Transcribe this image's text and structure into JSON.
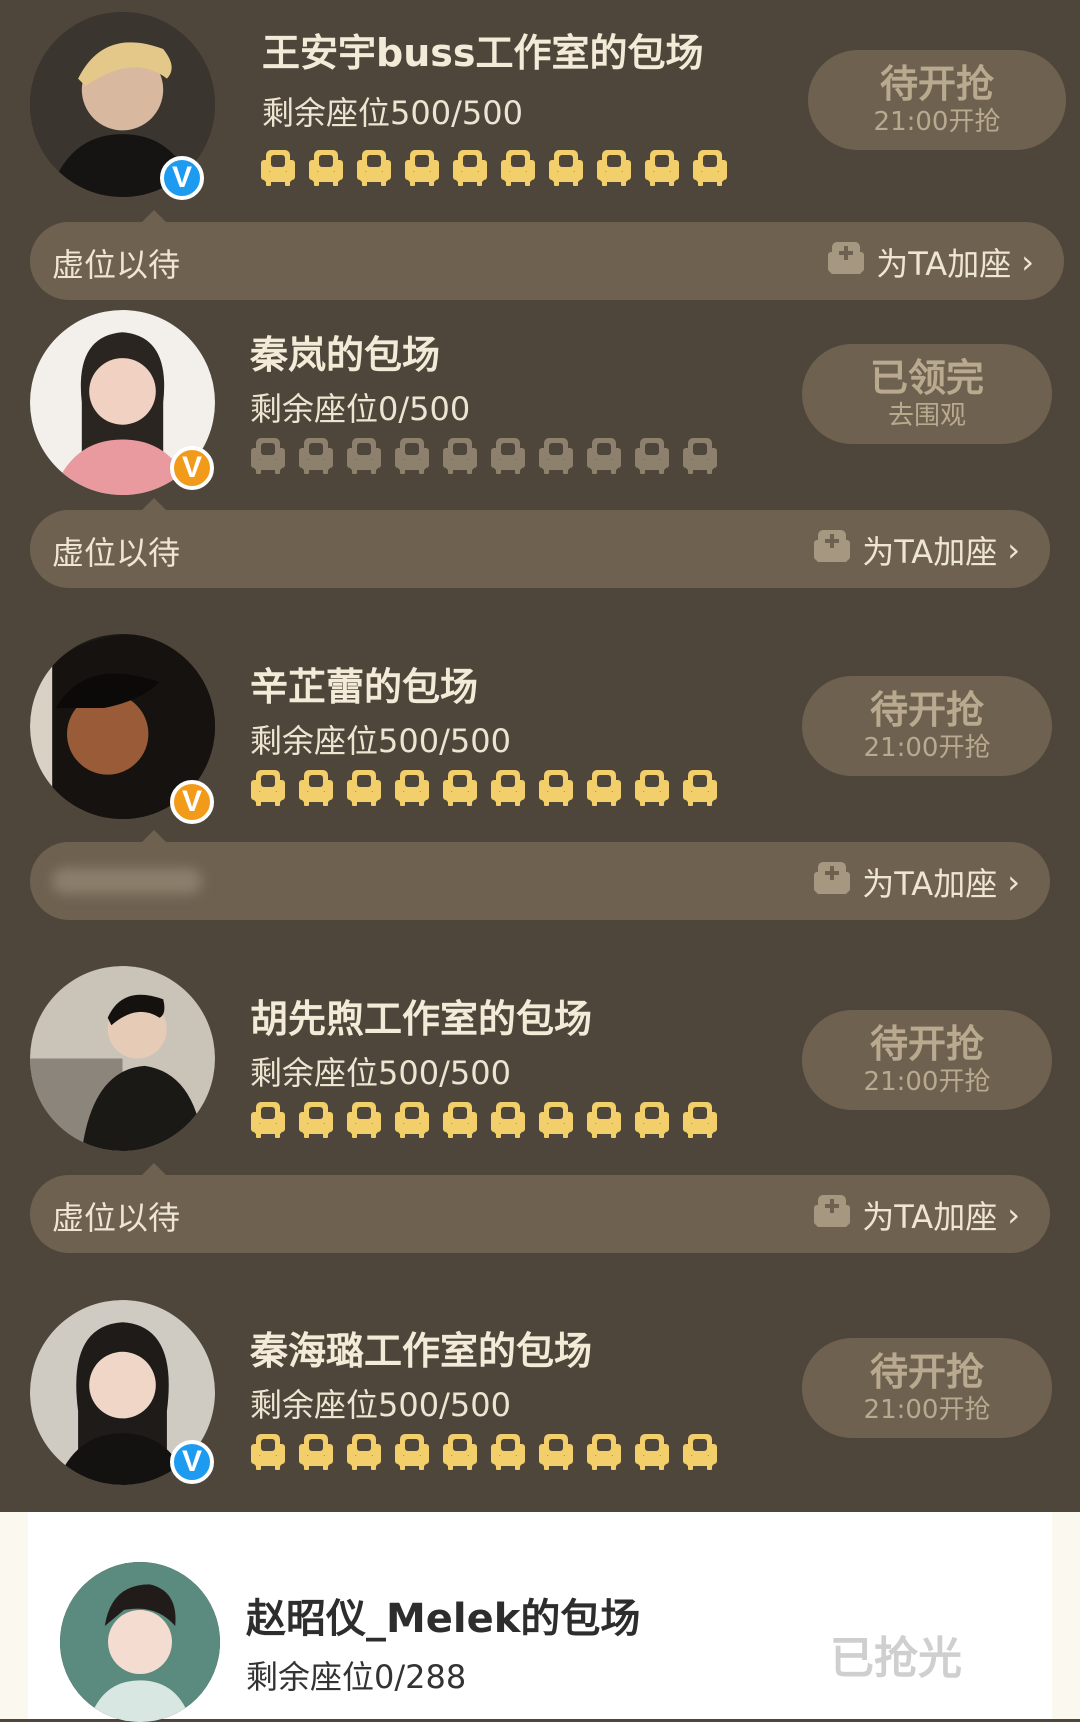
{
  "cards": [
    {
      "title": "王安宇buss工作室的包场",
      "seats": "剩余座位500/500",
      "status": "待开抢",
      "status_sub": "21:00开抢",
      "badge": "V",
      "seat_state": "available"
    },
    {
      "title": "秦岚的包场",
      "seats": "剩余座位0/500",
      "status": "已领完",
      "status_sub": "去围观",
      "badge": "V",
      "seat_state": "taken"
    },
    {
      "title": "辛芷蕾的包场",
      "seats": "剩余座位500/500",
      "status": "待开抢",
      "status_sub": "21:00开抢",
      "badge": "V",
      "seat_state": "available"
    },
    {
      "title": "胡先煦工作室的包场",
      "seats": "剩余座位500/500",
      "status": "待开抢",
      "status_sub": "21:00开抢",
      "badge": "",
      "seat_state": "available"
    },
    {
      "title": "秦海璐工作室的包场",
      "seats": "剩余座位500/500",
      "status": "待开抢",
      "status_sub": "21:00开抢",
      "badge": "V",
      "seat_state": "available"
    }
  ],
  "bars": [
    {
      "left": "虚位以待",
      "right": "为TA加座"
    },
    {
      "left": "虚位以待",
      "right": "为TA加座"
    },
    {
      "left": "",
      "right": "为TA加座"
    },
    {
      "left": "虚位以待",
      "right": "为TA加座"
    }
  ],
  "last": {
    "title": "赵昭仪_Melek的包场",
    "seats": "剩余座位0/288",
    "status": "已抢光"
  },
  "colors": {
    "background": "#4f463b",
    "pill": "#6e6150",
    "seat_available": "#f2cf6a",
    "seat_taken": "#8d806c",
    "badge_blue": "#1d9bf0",
    "badge_orange": "#f29a1a"
  },
  "icons": {
    "verified": "verified-badge-icon",
    "seat": "seat-icon",
    "add_seat": "add-seat-icon",
    "chevron": "chevron-right-icon"
  }
}
